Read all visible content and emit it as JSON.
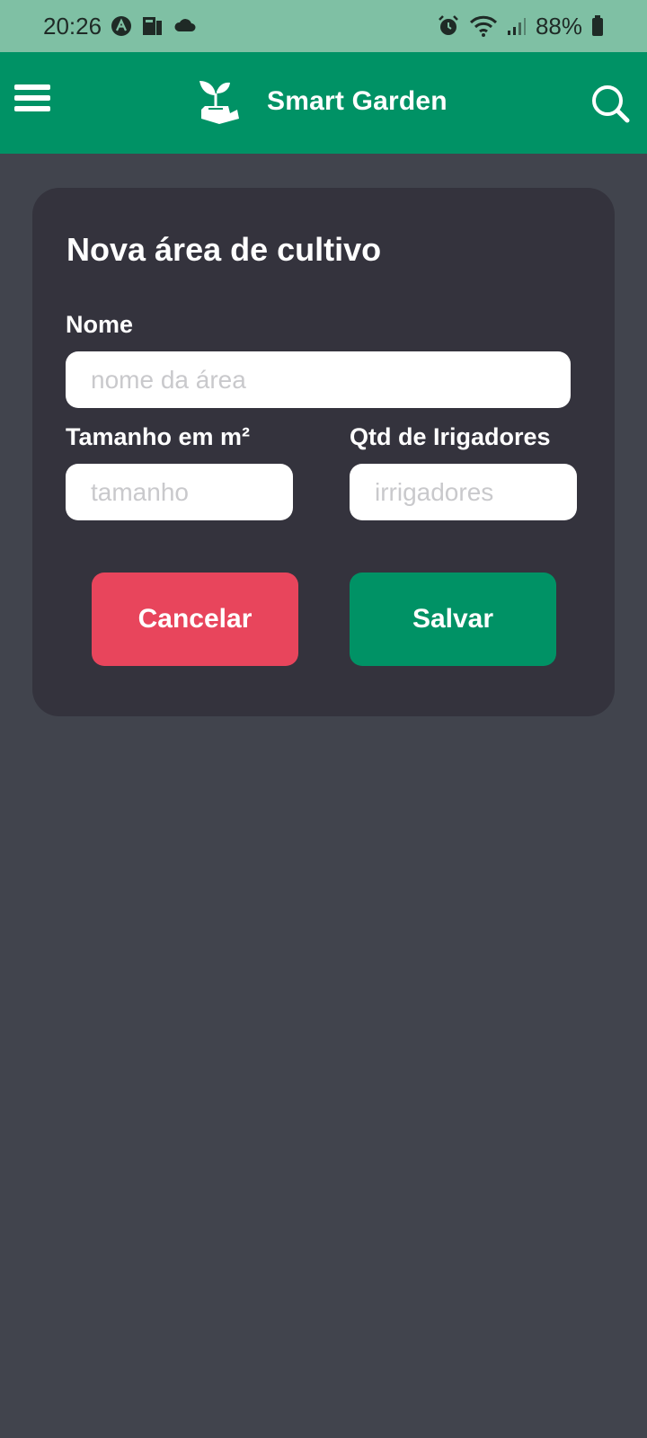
{
  "status_bar": {
    "time": "20:26",
    "battery": "88%"
  },
  "app_bar": {
    "title": "Smart Garden",
    "menu_icon": "hamburger-menu-icon",
    "logo_icon": "plant-in-hand-icon",
    "search_icon": "search-icon"
  },
  "form": {
    "title": "Nova área de cultivo",
    "name_label": "Nome",
    "name_placeholder": "nome da área",
    "name_value": "",
    "size_label": "Tamanho em m²",
    "size_placeholder": "tamanho",
    "size_value": "",
    "irrigators_label": "Qtd de Irigadores",
    "irrigators_placeholder": "irrigadores",
    "irrigators_value": "",
    "cancel_label": "Cancelar",
    "save_label": "Salvar"
  },
  "colors": {
    "status_bar": "#7fc0a4",
    "app_bar": "#009265",
    "background": "#41444d",
    "card": "#34333d",
    "cancel": "#e8455c",
    "save": "#009265"
  }
}
